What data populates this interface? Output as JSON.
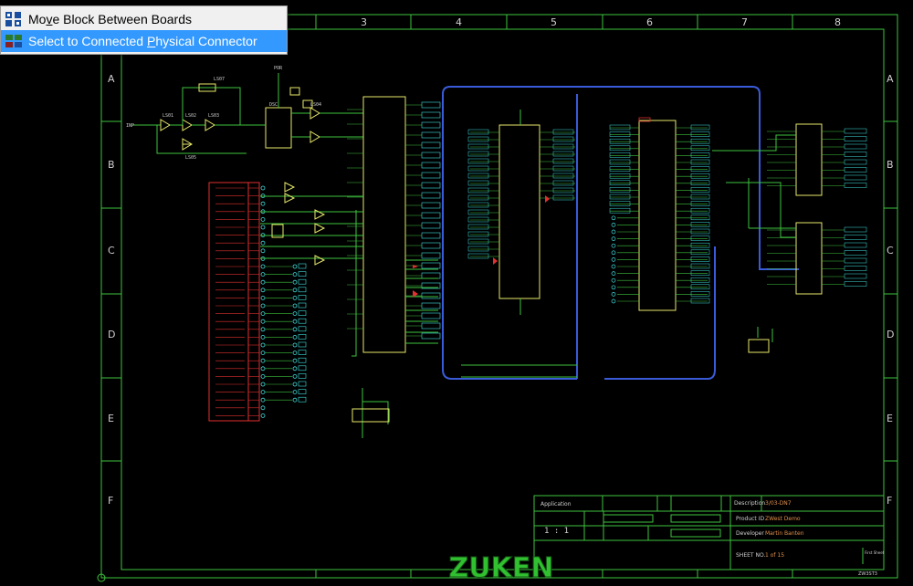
{
  "context_menu": {
    "items": [
      {
        "pre": "Mo",
        "key": "v",
        "post": "e Block Between Boards",
        "icon": "move-block-icon",
        "selected": false
      },
      {
        "pre": "Select to Connected ",
        "key": "P",
        "post": "hysical Connector",
        "icon": "select-connector-icon",
        "selected": true
      }
    ]
  },
  "colors": {
    "background": "#000000",
    "frame": "#3ec23e",
    "wire": "#3ec23e",
    "bus": "#3a5bd9",
    "component": "#e8e86a",
    "pin": "#40e0e0",
    "red": "#e03030",
    "label": "#cfcfcf",
    "menu_selected": "#3399ff",
    "logo": "#30c030"
  },
  "sheet": {
    "columns": [
      "3",
      "4",
      "5",
      "6",
      "7",
      "8"
    ],
    "rows": [
      "A",
      "B",
      "C",
      "D",
      "E",
      "F"
    ]
  },
  "title_block": {
    "application_label": "Application",
    "description_label": "Description",
    "description_value": "3/03-DN7",
    "product_id_label": "Product ID",
    "product_id_value": "ZWest Demo",
    "developer_label": "Developer",
    "developer_value": "Martin Banten",
    "sheet_no_label": "SHEET NO.",
    "sheet_no_value": "1 of 15",
    "scale": "1 : 1",
    "first_sheet": "First Sheet",
    "corner_code": "ZW3ST3"
  },
  "logo": "ZUKEN"
}
